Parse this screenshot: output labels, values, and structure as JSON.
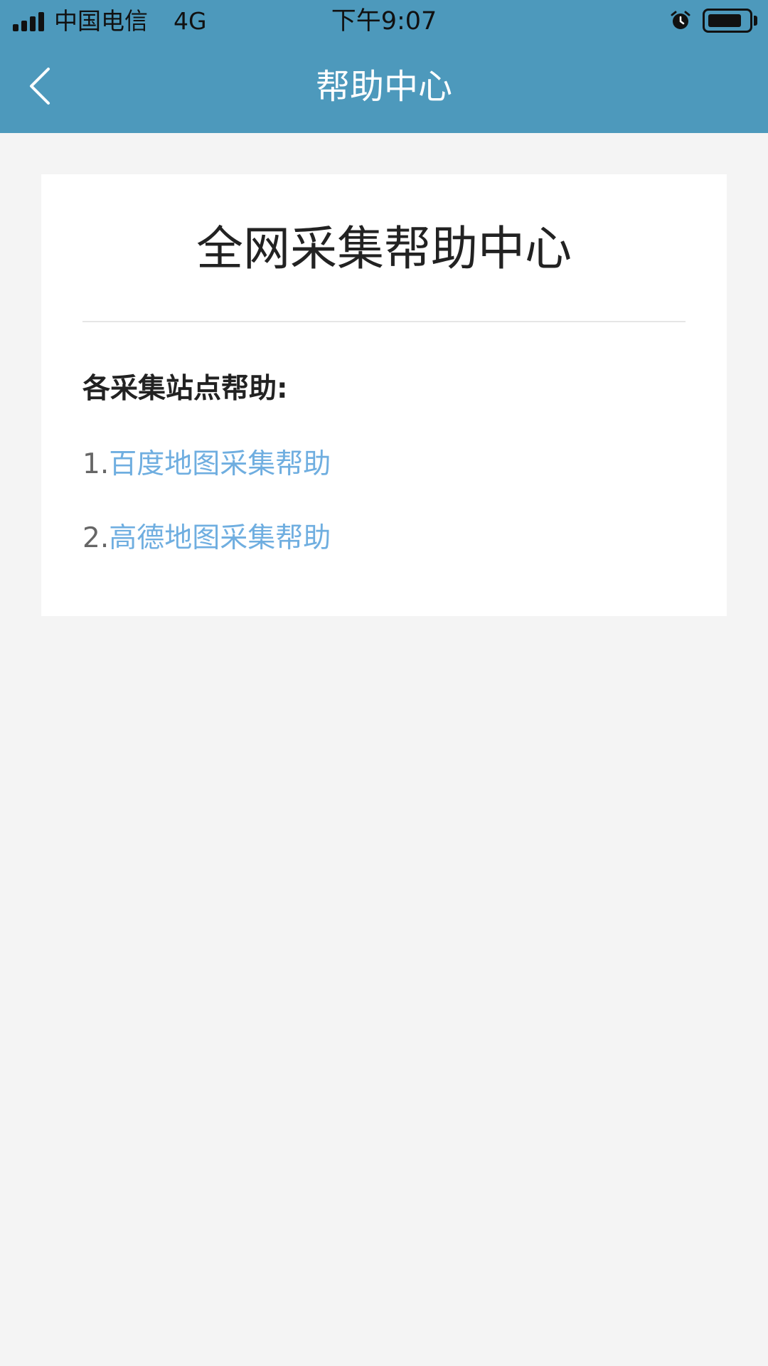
{
  "status_bar": {
    "carrier": "中国电信",
    "network": "4G",
    "time": "下午9:07",
    "alarm_icon": "alarm-icon",
    "battery_icon": "battery-icon",
    "battery_level": 0.8
  },
  "nav": {
    "back_icon": "chevron-left-icon",
    "title": "帮助中心"
  },
  "card": {
    "title": "全网采集帮助中心",
    "section_label": "各采集站点帮助:",
    "links": [
      {
        "number": "1.",
        "label": "百度地图采集帮助"
      },
      {
        "number": "2.",
        "label": "高德地图采集帮助"
      }
    ]
  },
  "colors": {
    "header_bg": "#4d99bc",
    "link": "#6faee0",
    "page_bg": "#f4f4f4"
  }
}
